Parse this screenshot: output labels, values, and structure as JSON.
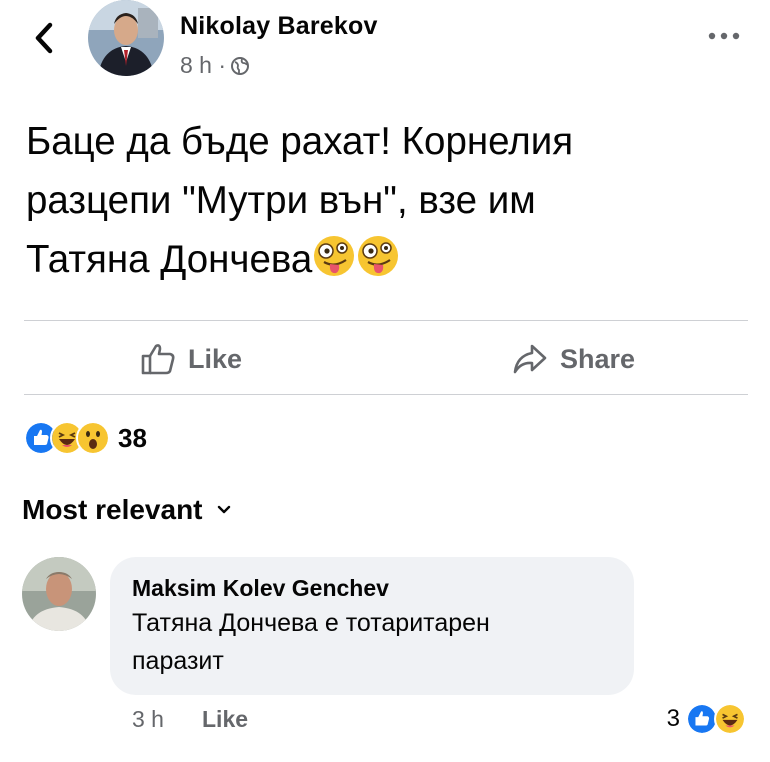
{
  "post": {
    "author": "Nikolay Barekov",
    "time": "8 h ·",
    "privacy_icon": "globe-icon",
    "text_lines": [
      "Баце да бъде рахат! Корнелия",
      "разцепи \"Мутри вън\", взе им",
      "Татяна Дончева"
    ],
    "emojis": [
      "zany-face-emoji",
      "zany-face-emoji"
    ]
  },
  "actions": {
    "like_label": "Like",
    "share_label": "Share"
  },
  "reactions": {
    "icons": [
      "like-icon",
      "haha-icon",
      "wow-icon"
    ],
    "count": "38"
  },
  "comments": {
    "sort_label": "Most relevant",
    "items": [
      {
        "author": "Maksim Kolev Genchev",
        "text_line1": "Татяна Дончева е тотаритарен",
        "text_line2": "паразит",
        "time": "3 h",
        "like_label": "Like",
        "reaction_count": "3",
        "reaction_icons": [
          "like-icon",
          "haha-icon"
        ]
      }
    ]
  },
  "colors": {
    "text": "#050505",
    "secondary": "#65676b",
    "bubble": "#f0f2f5",
    "like_blue": "#1877f2",
    "emoji_yellow": "#f7c531"
  }
}
